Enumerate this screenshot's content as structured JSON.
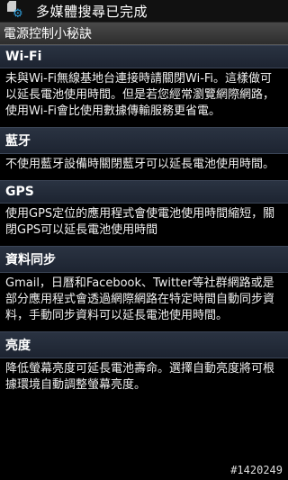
{
  "status_bar": {
    "notification_text": "多媒體搜尋已完成",
    "icons": [
      "sd-card-icon",
      "gear-icon"
    ]
  },
  "title_bar": {
    "title": "電源控制小秘訣"
  },
  "sections": [
    {
      "header": "Wi-Fi",
      "body": "未與Wi-Fi無線基地台連接時請關閉Wi-Fi。這樣做可以延長電池使用時間。但是若您經常瀏覽網際網路，使用Wi-Fi會比使用數據傳輸服務更省電。"
    },
    {
      "header": "藍牙",
      "body": "不使用藍牙設備時關閉藍牙可以延長電池使用時間。"
    },
    {
      "header": "GPS",
      "body": "使用GPS定位的應用程式會使電池使用時間縮短，關閉GPS可以延長電池使用時間"
    },
    {
      "header": "資料同步",
      "body": "Gmail，日曆和Facebook、Twitter等社群網路或是部分應用程式會透過網際網路在特定時間自動同步資料，手動同步資料可以延長電池使用時間。"
    },
    {
      "header": "亮度",
      "body": "降低螢幕亮度可延長電池壽命。選擇自動亮度將可根據環境自動調整螢幕亮度。"
    }
  ],
  "watermark": "#1420249"
}
